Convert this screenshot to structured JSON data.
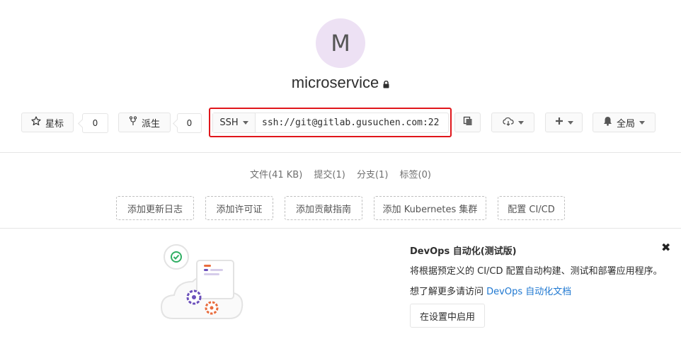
{
  "project": {
    "avatar_letter": "M",
    "name": "microservice"
  },
  "actions": {
    "star_label": "星标",
    "star_count": "0",
    "fork_label": "派生",
    "fork_count": "0",
    "clone_protocol": "SSH",
    "clone_url": "ssh://git@gitlab.gusuchen.com:22",
    "notify_label": "全局"
  },
  "stats": {
    "files": "文件(41 KB)",
    "commits": "提交(1)",
    "branches": "分支(1)",
    "tags": "标签(0)"
  },
  "quick_links": [
    "添加更新日志",
    "添加许可证",
    "添加贡献指南",
    "添加 Kubernetes 集群",
    "配置 CI/CD"
  ],
  "devops": {
    "title": "DevOps 自动化(测试版)",
    "description": "将根据预定义的 CI/CD 配置自动构建、测试和部署应用程序。",
    "more_prefix": "想了解更多请访问",
    "more_link": "DevOps 自动化文档",
    "enable_button": "在设置中启用",
    "close": "✖"
  }
}
